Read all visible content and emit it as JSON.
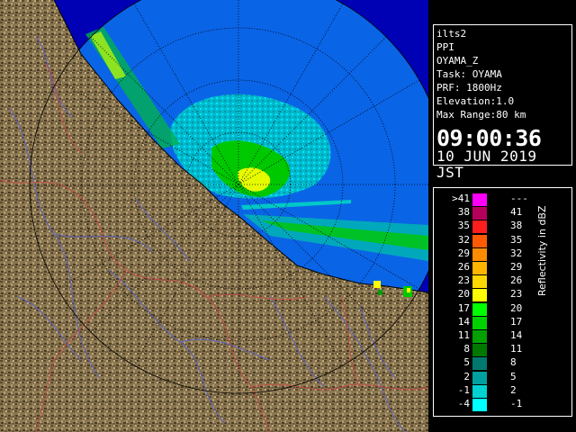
{
  "info": {
    "lines": [
      "ilts2",
      "PPI",
      "OYAMA_Z",
      "Task: OYAMA",
      "PRF: 1800Hz",
      "Elevation:1.0",
      "Max Range:80 km"
    ],
    "time": "09:00:36",
    "date": "10 JUN 2019 JST"
  },
  "legend": {
    "unit_label": "Reflectivity in dBZ",
    "left_labels": [
      ">41",
      "38",
      "35",
      "32",
      "29",
      "26",
      "23",
      "20",
      "17",
      "14",
      "11",
      "8",
      "5",
      "2",
      "-1",
      "-4"
    ],
    "right_labels": [
      "---",
      "41",
      "38",
      "35",
      "32",
      "29",
      "26",
      "23",
      "20",
      "17",
      "14",
      "11",
      "8",
      "5",
      "2",
      "-1"
    ],
    "colors": [
      "#ff00ff",
      "#b4005a",
      "#ff1e1e",
      "#ff5a00",
      "#ff8c00",
      "#ffb400",
      "#ffd700",
      "#ffff00",
      "#00ff00",
      "#00d200",
      "#00a000",
      "#007800",
      "#00786e",
      "#00a0a0",
      "#00d2d2",
      "#00ffff"
    ]
  },
  "colors": {
    "background": "#000000",
    "ocean_coverage": "#0a64e6",
    "outside_range": "#0000b4",
    "land": "#8c7852",
    "rivers": "#5a64c8",
    "boundaries": "#c84646"
  }
}
